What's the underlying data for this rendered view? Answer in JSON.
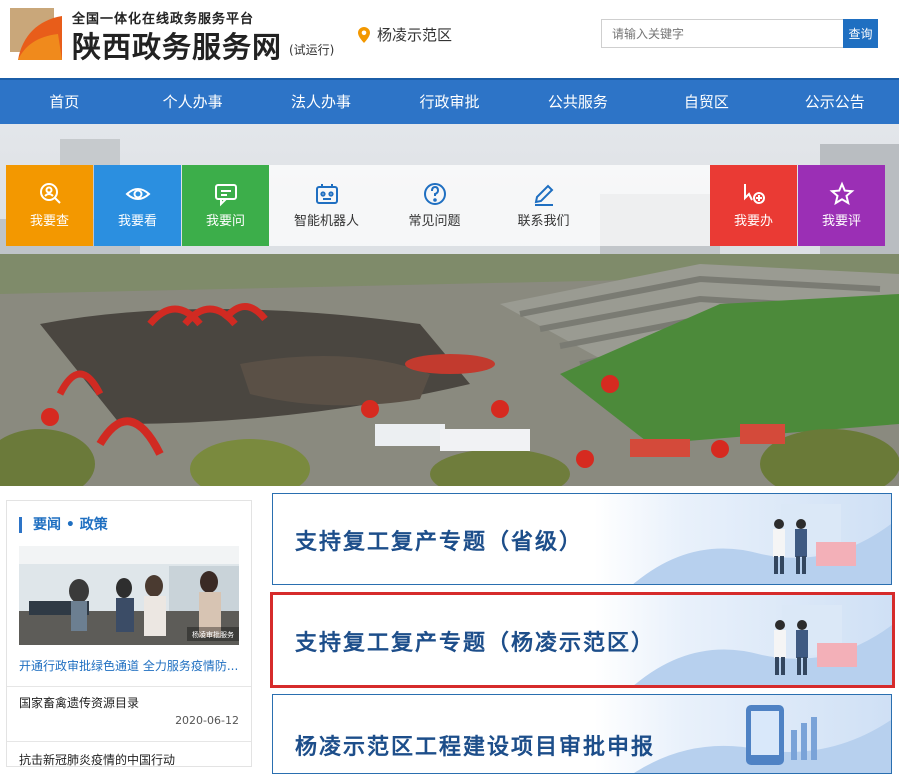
{
  "header": {
    "subtitle": "全国一体化在线政务服务平台",
    "title": "陕西政务服务网",
    "trial": "(试运行)",
    "location": "杨凌示范区",
    "search_placeholder": "请输入关键字",
    "search_button": "查询"
  },
  "nav": [
    "首页",
    "个人办事",
    "法人办事",
    "行政审批",
    "公共服务",
    "自贸区",
    "公示公告"
  ],
  "tiles": [
    {
      "label": "我要查",
      "icon": "search-person-icon",
      "color": "#f39800"
    },
    {
      "label": "我要看",
      "icon": "eye-icon",
      "color": "#2b8fe0"
    },
    {
      "label": "我要问",
      "icon": "chat-icon",
      "color": "#3cae4a"
    },
    {
      "label": "智能机器人",
      "icon": "robot-icon",
      "color": "transparent"
    },
    {
      "label": "常见问题",
      "icon": "question-icon",
      "color": "transparent"
    },
    {
      "label": "联系我们",
      "icon": "pen-icon",
      "color": "transparent"
    },
    {
      "label": "我要办",
      "icon": "cursor-plus-icon",
      "color": "#ea3a34"
    },
    {
      "label": "我要评",
      "icon": "star-icon",
      "color": "#9b2fb5"
    }
  ],
  "news": {
    "section_title": "要闻 • 政策",
    "image_tag": "杨凌审批服务",
    "featured_caption": "开通行政审批绿色通道 全力服务疫情防...",
    "items": [
      {
        "title": "国家畜禽遗传资源目录",
        "date": "2020-06-12"
      },
      {
        "title": "抗击新冠肺炎疫情的中国行动",
        "date": ""
      }
    ]
  },
  "topics": [
    "支持复工复产专题（省级）",
    "支持复工复产专题（杨凌示范区）",
    "杨凌示范区工程建设项目审批申报"
  ]
}
